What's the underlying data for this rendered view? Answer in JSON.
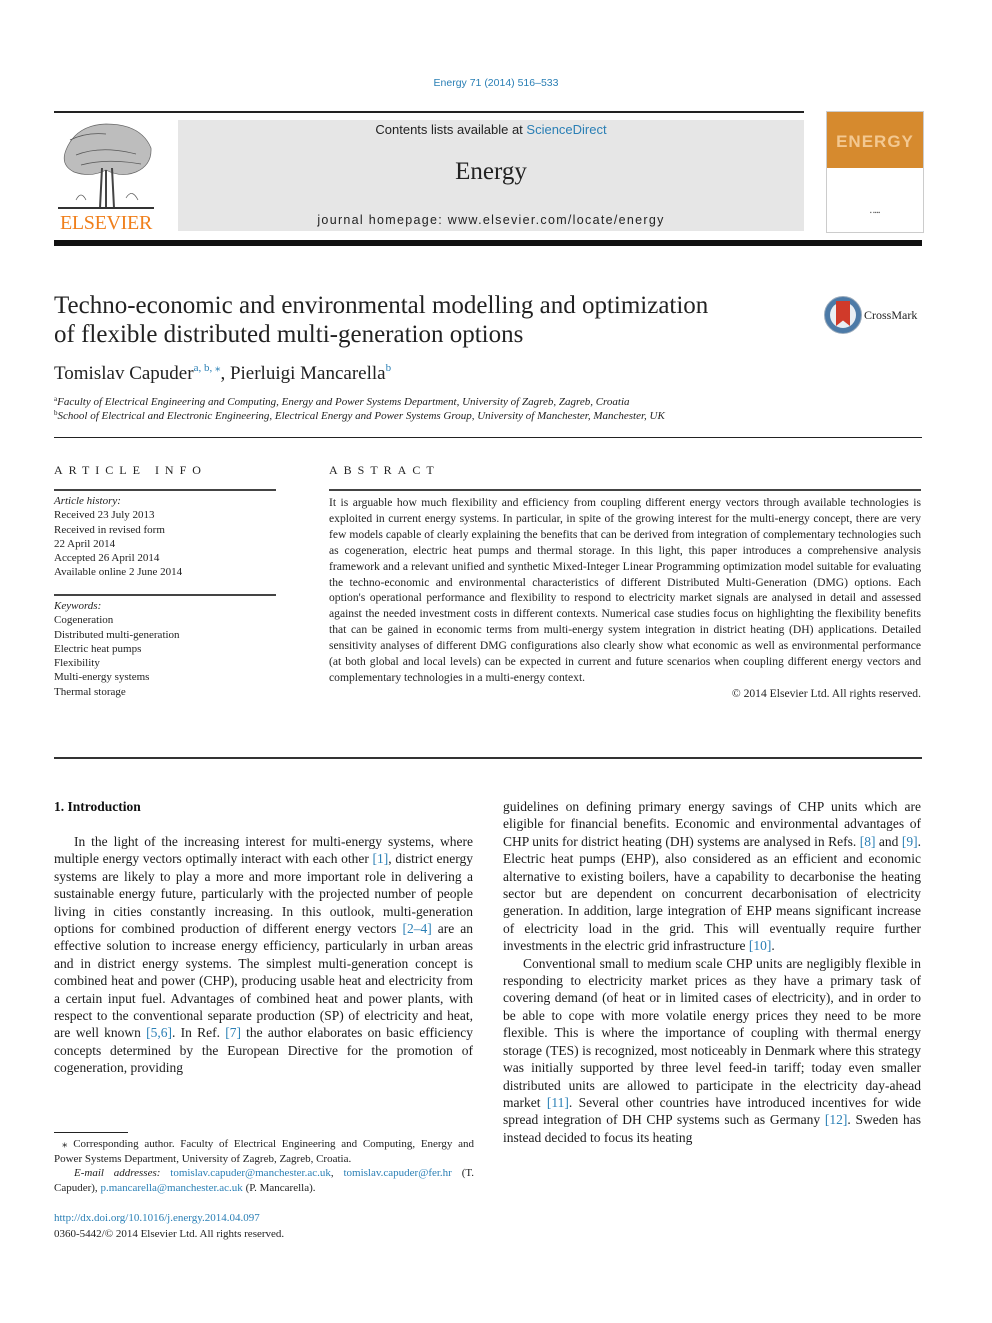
{
  "citation": "Energy 71 (2014) 516–533",
  "header": {
    "publisher_logo": "ELSEVIER",
    "contents_prefix": "Contents lists available at ",
    "contents_link": "ScienceDirect",
    "journal_name": "Energy",
    "homepage_label": "journal homepage: www.elsevier.com/locate/energy",
    "cover_title": "ENERGY"
  },
  "colors": {
    "link": "#2a7fb5",
    "elsevier_orange": "#f07f1b",
    "header_bg": "#e6e6e6",
    "cover_orange": "#d68a2e"
  },
  "article": {
    "title_line1": "Techno-economic and environmental modelling and optimization",
    "title_line2": "of flexible distributed multi-generation options",
    "crossmark_label": "CrossMark",
    "authors": [
      {
        "name": "Tomislav Capuder",
        "sup": "a, b, ⁎",
        "sep": ", "
      },
      {
        "name": "Pierluigi Mancarella",
        "sup": "b",
        "sep": ""
      }
    ],
    "affiliations": [
      {
        "mark": "a",
        "text": "Faculty of Electrical Engineering and Computing, Energy and Power Systems Department, University of Zagreb, Zagreb, Croatia"
      },
      {
        "mark": "b",
        "text": "School of Electrical and Electronic Engineering, Electrical Energy and Power Systems Group, University of Manchester, Manchester, UK"
      }
    ]
  },
  "article_info": {
    "heading": "ARTICLE INFO",
    "history_label": "Article history:",
    "history": [
      "Received 23 July 2013",
      "Received in revised form",
      "22 April 2014",
      "Accepted 26 April 2014",
      "Available online 2 June 2014"
    ],
    "keywords_label": "Keywords:",
    "keywords": [
      "Cogeneration",
      "Distributed multi-generation",
      "Electric heat pumps",
      "Flexibility",
      "Multi-energy systems",
      "Thermal storage"
    ]
  },
  "abstract": {
    "heading": "ABSTRACT",
    "text": "It is arguable how much flexibility and efficiency from coupling different energy vectors through available technologies is exploited in current energy systems. In particular, in spite of the growing interest for the multi-energy concept, there are very few models capable of clearly explaining the benefits that can be derived from integration of complementary technologies such as cogeneration, electric heat pumps and thermal storage. In this light, this paper introduces a comprehensive analysis framework and a relevant unified and synthetic Mixed-Integer Linear Programming optimization model suitable for evaluating the techno-economic and environmental characteristics of different Distributed Multi-Generation (DMG) options. Each option's operational performance and flexibility to respond to electricity market signals are analysed in detail and assessed against the needed investment costs in different contexts. Numerical case studies focus on highlighting the flexibility benefits that can be gained in economic terms from multi-energy system integration in district heating (DH) applications. Detailed sensitivity analyses of different DMG configurations also clearly show what economic as well as environmental performance (at both global and local levels) can be expected in current and future scenarios when coupling different energy vectors and complementary technologies in a multi-energy context.",
    "rights": "© 2014 Elsevier Ltd. All rights reserved."
  },
  "body": {
    "section_heading": "1.  Introduction",
    "left_para": [
      {
        "t": "In the light of the increasing interest for multi-energy systems, where multiple energy vectors optimally interact with each other "
      },
      {
        "ref": "[1]"
      },
      {
        "t": ", district energy systems are likely to play a more and more important role in delivering a sustainable energy future, particularly with the projected number of people living in cities constantly increasing. In this outlook, multi-generation options for combined production of different energy vectors "
      },
      {
        "ref": "[2–4]"
      },
      {
        "t": " are an effective solution to increase energy efficiency, particularly in urban areas and in district energy systems. The simplest multi-generation concept is combined heat and power (CHP), producing usable heat and electricity from a certain input fuel. Advantages of combined heat and power plants, with respect to the conventional separate production (SP) of electricity and heat, are well known "
      },
      {
        "ref": "[5,6]"
      },
      {
        "t": ". In Ref. "
      },
      {
        "ref": "[7]"
      },
      {
        "t": " the author elaborates on basic efficiency concepts determined by the European Directive for the promotion of cogeneration, providing"
      }
    ],
    "right_para1": [
      {
        "t": "guidelines on defining primary energy savings of CHP units which are eligible for financial benefits. Economic and environmental advantages of CHP units for district heating (DH) systems are analysed in Refs. "
      },
      {
        "ref": "[8]"
      },
      {
        "t": " and "
      },
      {
        "ref": "[9]"
      },
      {
        "t": ". Electric heat pumps (EHP), also considered as an efficient and economic alternative to existing boilers, have a capability to decarbonise the heating sector but are dependent on concurrent decarbonisation of electricity generation. In addition, large integration of EHP means significant increase of electricity load in the grid. This will eventually require further investments in the electric grid infrastructure "
      },
      {
        "ref": "[10]"
      },
      {
        "t": "."
      }
    ],
    "right_para2": [
      {
        "t": "Conventional small to medium scale CHP units are negligibly flexible in responding to electricity market prices as they have a primary task of covering demand (of heat or in limited cases of electricity), and in order to be able to cope with more volatile energy prices they need to be more flexible. This is where the importance of coupling with thermal energy storage (TES) is recognized, most noticeably in Denmark where this strategy was initially supported by three level feed-in tariff; today even smaller distributed units are allowed to participate in the electricity day-ahead market "
      },
      {
        "ref": "[11]"
      },
      {
        "t": ". Several other countries have introduced incentives for wide spread integration of DH CHP systems such as Germany "
      },
      {
        "ref": "[12]"
      },
      {
        "t": ". Sweden has instead decided to focus its heating"
      }
    ]
  },
  "footnote": {
    "corresponding": "⁎  Corresponding author. Faculty of Electrical Engineering and Computing, Energy and Power Systems Department, University of Zagreb, Zagreb, Croatia.",
    "email_label": "E-mail addresses:",
    "email1": "tomislav.capuder@manchester.ac.uk",
    "email2": "tomislav.capuder@fer.hr",
    "email1_owner": "(T. Capuder), ",
    "email3": "p.mancarella@manchester.ac.uk",
    "email3_owner": " (P. Mancarella)."
  },
  "doi": {
    "link": "http://dx.doi.org/10.1016/j.energy.2014.04.097",
    "issn": "0360-5442/© 2014 Elsevier Ltd. All rights reserved."
  }
}
